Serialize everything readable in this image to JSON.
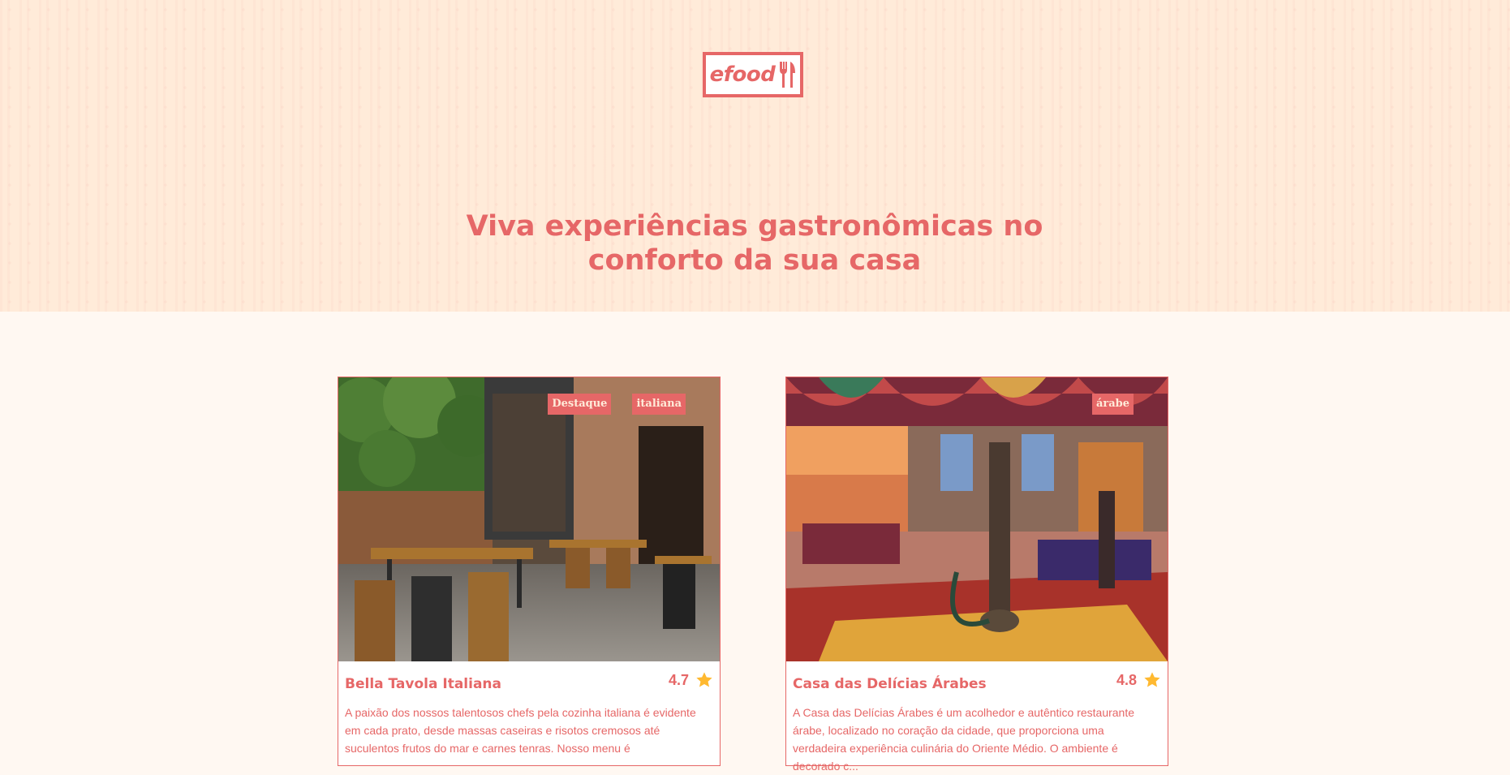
{
  "header": {
    "logo_text": "efood",
    "logo_icon": "fork-knife-icon",
    "title": "Viva experiências gastronômicas no conforto da sua casa"
  },
  "colors": {
    "brand": "#E66767",
    "hero_bg": "#FFEBD9",
    "page_bg": "#FFF8F2",
    "star": "#FFB930"
  },
  "restaurants": [
    {
      "name": "Bella Tavola Italiana",
      "rating": "4.7",
      "tags": [
        "Destaque",
        "italiana"
      ],
      "image_icon": "restaurant-photo",
      "description": "A paixão dos nossos talentosos chefs pela cozinha italiana é evidente em cada prato, desde massas caseiras e risotos cremosos até suculentos frutos do mar e carnes tenras. Nosso menu é"
    },
    {
      "name": "Casa das Delícias Árabes",
      "rating": "4.8",
      "tags": [
        "árabe"
      ],
      "image_icon": "restaurant-photo",
      "description": "A Casa das Delícias Árabes é um acolhedor e autêntico restaurante árabe, localizado no coração da cidade, que proporciona uma verdadeira experiência culinária do Oriente Médio. O ambiente é decorado c..."
    }
  ]
}
